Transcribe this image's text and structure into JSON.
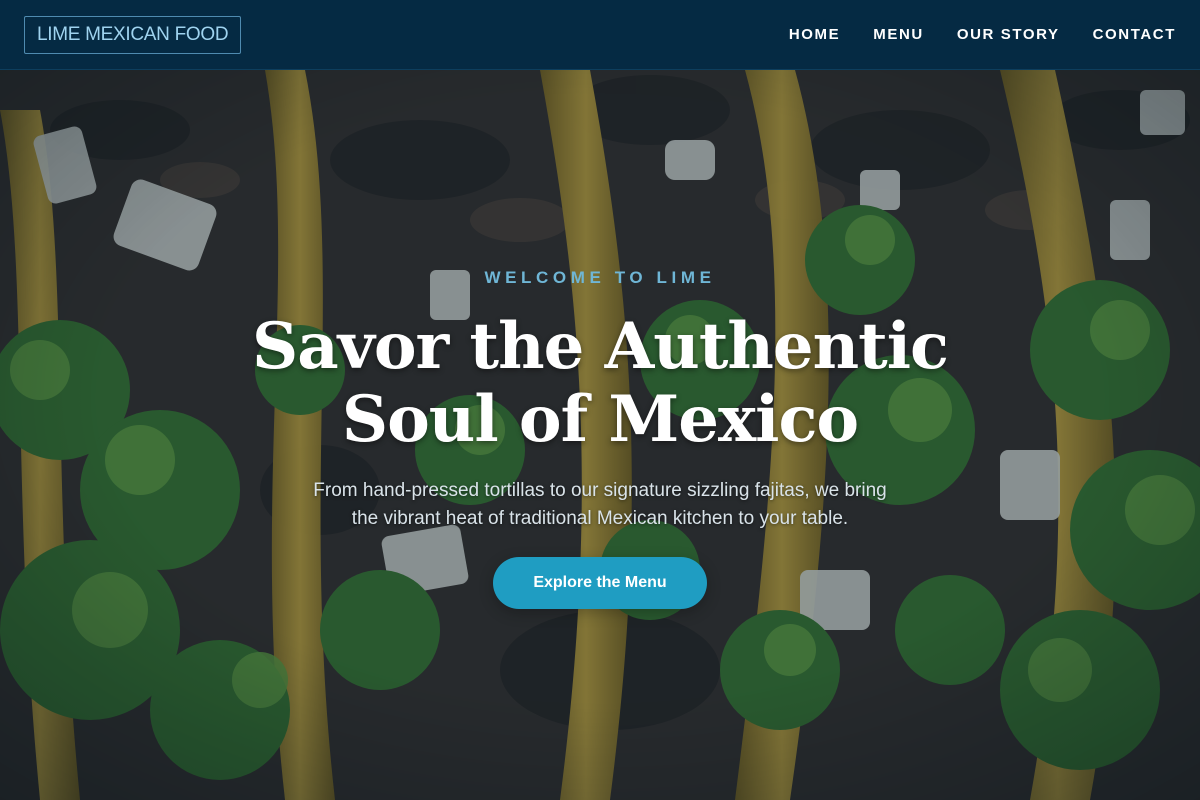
{
  "header": {
    "logo": "LIME MEXICAN FOOD",
    "nav": [
      {
        "label": "HOME"
      },
      {
        "label": "MENU"
      },
      {
        "label": "OUR STORY"
      },
      {
        "label": "CONTACT"
      }
    ]
  },
  "hero": {
    "eyebrow": "WELCOME TO LIME",
    "title_lines": [
      "Savor the Authentic",
      "Soul of Mexico"
    ],
    "subtitle_lines": [
      "From hand-pressed tortillas to our signature sizzling fajitas, we bring",
      "the vibrant heat of traditional Mexican kitchen to your table."
    ],
    "cta_label": "Explore the Menu",
    "background_image": "tacos-photo"
  },
  "colors": {
    "header_bg": "#052a43",
    "accent": "#1f9dc2",
    "logo_text": "#9fd3ef",
    "eyebrow": "#6fb6d6"
  }
}
